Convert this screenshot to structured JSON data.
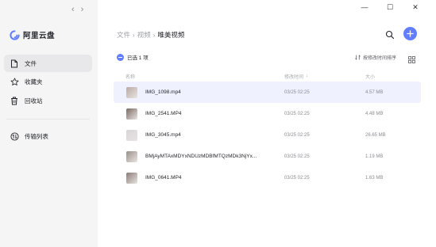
{
  "nav_arrows": {
    "back": "‹",
    "forward": "›"
  },
  "window_controls": {
    "minimize": "—",
    "maximize": "☐",
    "close": "✕"
  },
  "app": {
    "name": "阿里云盘",
    "brand_color": "#637dff"
  },
  "sidebar": {
    "items": [
      {
        "label": "文件",
        "icon": "file-icon",
        "active": true
      },
      {
        "label": "收藏夹",
        "icon": "star-icon",
        "active": false
      },
      {
        "label": "回收站",
        "icon": "trash-icon",
        "active": false
      }
    ],
    "transfer": {
      "label": "传输列表",
      "icon": "transfer-icon"
    }
  },
  "breadcrumb": {
    "items": [
      "文件",
      "视频"
    ],
    "current": "唯美视频",
    "separator": "›"
  },
  "toolbar": {
    "selection_text": "已选 1 项",
    "sort_text": "按修改时间排序"
  },
  "table": {
    "headers": {
      "name": "名称",
      "modified": "修改时间",
      "size": "大小",
      "sort_arrow": "↓"
    },
    "rows": [
      {
        "name": "IMG_1098.mp4",
        "modified": "03/25 02:25",
        "size": "4.57 MB",
        "selected": true,
        "thumb": "#b9a9a4"
      },
      {
        "name": "IMG_2541.MP4",
        "modified": "03/25 02:25",
        "size": "4.48 MB",
        "selected": false,
        "thumb": "#7a6a62"
      },
      {
        "name": "IMG_3045.mp4",
        "modified": "03/25 02:25",
        "size": "26.65 MB",
        "selected": false,
        "thumb": "#d8d3d8"
      },
      {
        "name": "BMjAyMTAxMDYxNDUzMDBfMTQzMDk3NjYx...",
        "modified": "03/25 02:25",
        "size": "1.19 MB",
        "selected": false,
        "thumb": "#9a8f88"
      },
      {
        "name": "IMG_0641.MP4",
        "modified": "03/25 02:25",
        "size": "1.63 MB",
        "selected": false,
        "thumb": "#8a7c76"
      }
    ]
  }
}
